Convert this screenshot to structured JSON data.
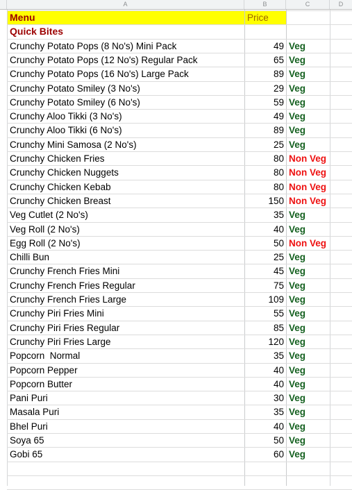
{
  "spreadsheet": {
    "column_headers": [
      "A",
      "B",
      "C",
      "D"
    ],
    "header_row": {
      "menu_label": "Menu",
      "price_label": "Price"
    },
    "section_label": "Quick Bites",
    "colors": {
      "header_fill": "#ffff00",
      "title_text": "#9c0000",
      "price_header_text": "#9c6500",
      "veg_text": "#14601f",
      "nonveg_text": "#ee1111",
      "gridline": "#dcdcdc",
      "colheader_fill": "#f1f3f4"
    },
    "rows": [
      {
        "name": "Crunchy Potato Pops (8 No's) Mini Pack",
        "price": "49",
        "type": "Veg"
      },
      {
        "name": "Crunchy Potato Pops (12 No's) Regular Pack",
        "price": "65",
        "type": "Veg"
      },
      {
        "name": "Crunchy Potato Pops (16 No's) Large Pack",
        "price": "89",
        "type": "Veg"
      },
      {
        "name": "Crunchy Potato Smiley (3 No's)",
        "price": "29",
        "type": "Veg"
      },
      {
        "name": "Crunchy Potato Smiley (6 No's)",
        "price": "59",
        "type": "Veg"
      },
      {
        "name": "Crunchy Aloo Tikki (3 No's)",
        "price": "49",
        "type": "Veg"
      },
      {
        "name": "Crunchy Aloo Tikki (6 No's)",
        "price": "89",
        "type": "Veg"
      },
      {
        "name": "Crunchy Mini Samosa (2 No's)",
        "price": "25",
        "type": "Veg"
      },
      {
        "name": "Crunchy Chicken Fries",
        "price": "80",
        "type": "Non Veg"
      },
      {
        "name": "Crunchy Chicken Nuggets",
        "price": "80",
        "type": "Non Veg"
      },
      {
        "name": "Crunchy Chicken Kebab",
        "price": "80",
        "type": "Non Veg"
      },
      {
        "name": "Crunchy Chicken Breast",
        "price": "150",
        "type": "Non Veg"
      },
      {
        "name": "Veg Cutlet (2 No's)",
        "price": "35",
        "type": "Veg"
      },
      {
        "name": "Veg Roll (2 No's)",
        "price": "40",
        "type": "Veg"
      },
      {
        "name": "Egg Roll (2 No's)",
        "price": "50",
        "type": "Non Veg"
      },
      {
        "name": "Chilli Bun",
        "price": "25",
        "type": "Veg"
      },
      {
        "name": "Crunchy French Fries Mini",
        "price": "45",
        "type": "Veg"
      },
      {
        "name": "Crunchy French Fries Regular",
        "price": "75",
        "type": "Veg"
      },
      {
        "name": "Crunchy French Fries Large",
        "price": "109",
        "type": "Veg"
      },
      {
        "name": "Crunchy Piri Fries Mini",
        "price": "55",
        "type": "Veg"
      },
      {
        "name": "Crunchy Piri Fries Regular",
        "price": "85",
        "type": "Veg"
      },
      {
        "name": "Crunchy Piri Fries Large",
        "price": "120",
        "type": "Veg"
      },
      {
        "name": "Popcorn  Normal",
        "price": "35",
        "type": "Veg"
      },
      {
        "name": "Popcorn Pepper",
        "price": "40",
        "type": "Veg"
      },
      {
        "name": "Popcorn Butter",
        "price": "40",
        "type": "Veg"
      },
      {
        "name": "Pani Puri",
        "price": "30",
        "type": "Veg"
      },
      {
        "name": "Masala Puri",
        "price": "35",
        "type": "Veg"
      },
      {
        "name": "Bhel Puri",
        "price": "40",
        "type": "Veg"
      },
      {
        "name": "Soya 65",
        "price": "50",
        "type": "Veg"
      },
      {
        "name": "Gobi 65",
        "price": "60",
        "type": "Veg"
      }
    ]
  }
}
